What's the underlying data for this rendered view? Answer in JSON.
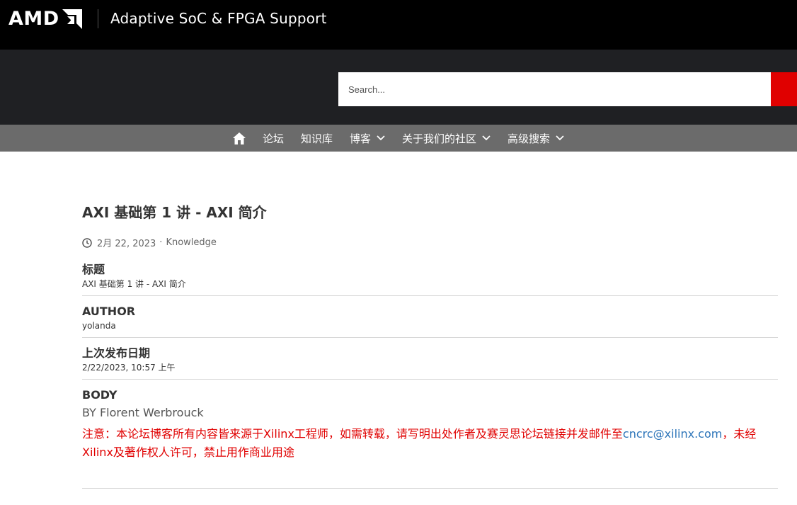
{
  "header": {
    "brand": "AMD",
    "site_title": "Adaptive SoC & FPGA Support"
  },
  "search": {
    "placeholder": "Search...",
    "button_color": "#e00000"
  },
  "nav": {
    "home_icon": "home-icon",
    "items": [
      {
        "label": "论坛",
        "dropdown": false
      },
      {
        "label": "知识库",
        "dropdown": false
      },
      {
        "label": "博客",
        "dropdown": true
      },
      {
        "label": "关于我们的社区",
        "dropdown": true
      },
      {
        "label": "高级搜索",
        "dropdown": true
      }
    ]
  },
  "post": {
    "title": "AXI 基础第 1 讲 - AXI 简介",
    "date": "2月 22, 2023",
    "separator": "·",
    "category": "Knowledge",
    "fields": [
      {
        "label": "标题",
        "value": "AXI 基础第 1 讲 - AXI 简介"
      },
      {
        "label": "AUTHOR",
        "value": "yolanda"
      },
      {
        "label": "上次发布日期",
        "value": "2/22/2023, 10:57 上午"
      }
    ],
    "body_label": "BODY",
    "body_by": "BY Florent Werbrouck",
    "notice_before": "注意：本论坛博客所有内容皆来源于Xilinx工程师，如需转载，请写明出处作者及赛灵思论坛链接并发邮件至",
    "notice_email": "cncrc@xilinx.com",
    "notice_after": "，未经Xilinx及著作权人许可，禁止用作商业用途"
  },
  "colors": {
    "topbar": "#000000",
    "hero": "#1f2023",
    "nav": "#6b6b6b",
    "accent_red": "#e00000",
    "link_blue": "#2a73b8"
  }
}
